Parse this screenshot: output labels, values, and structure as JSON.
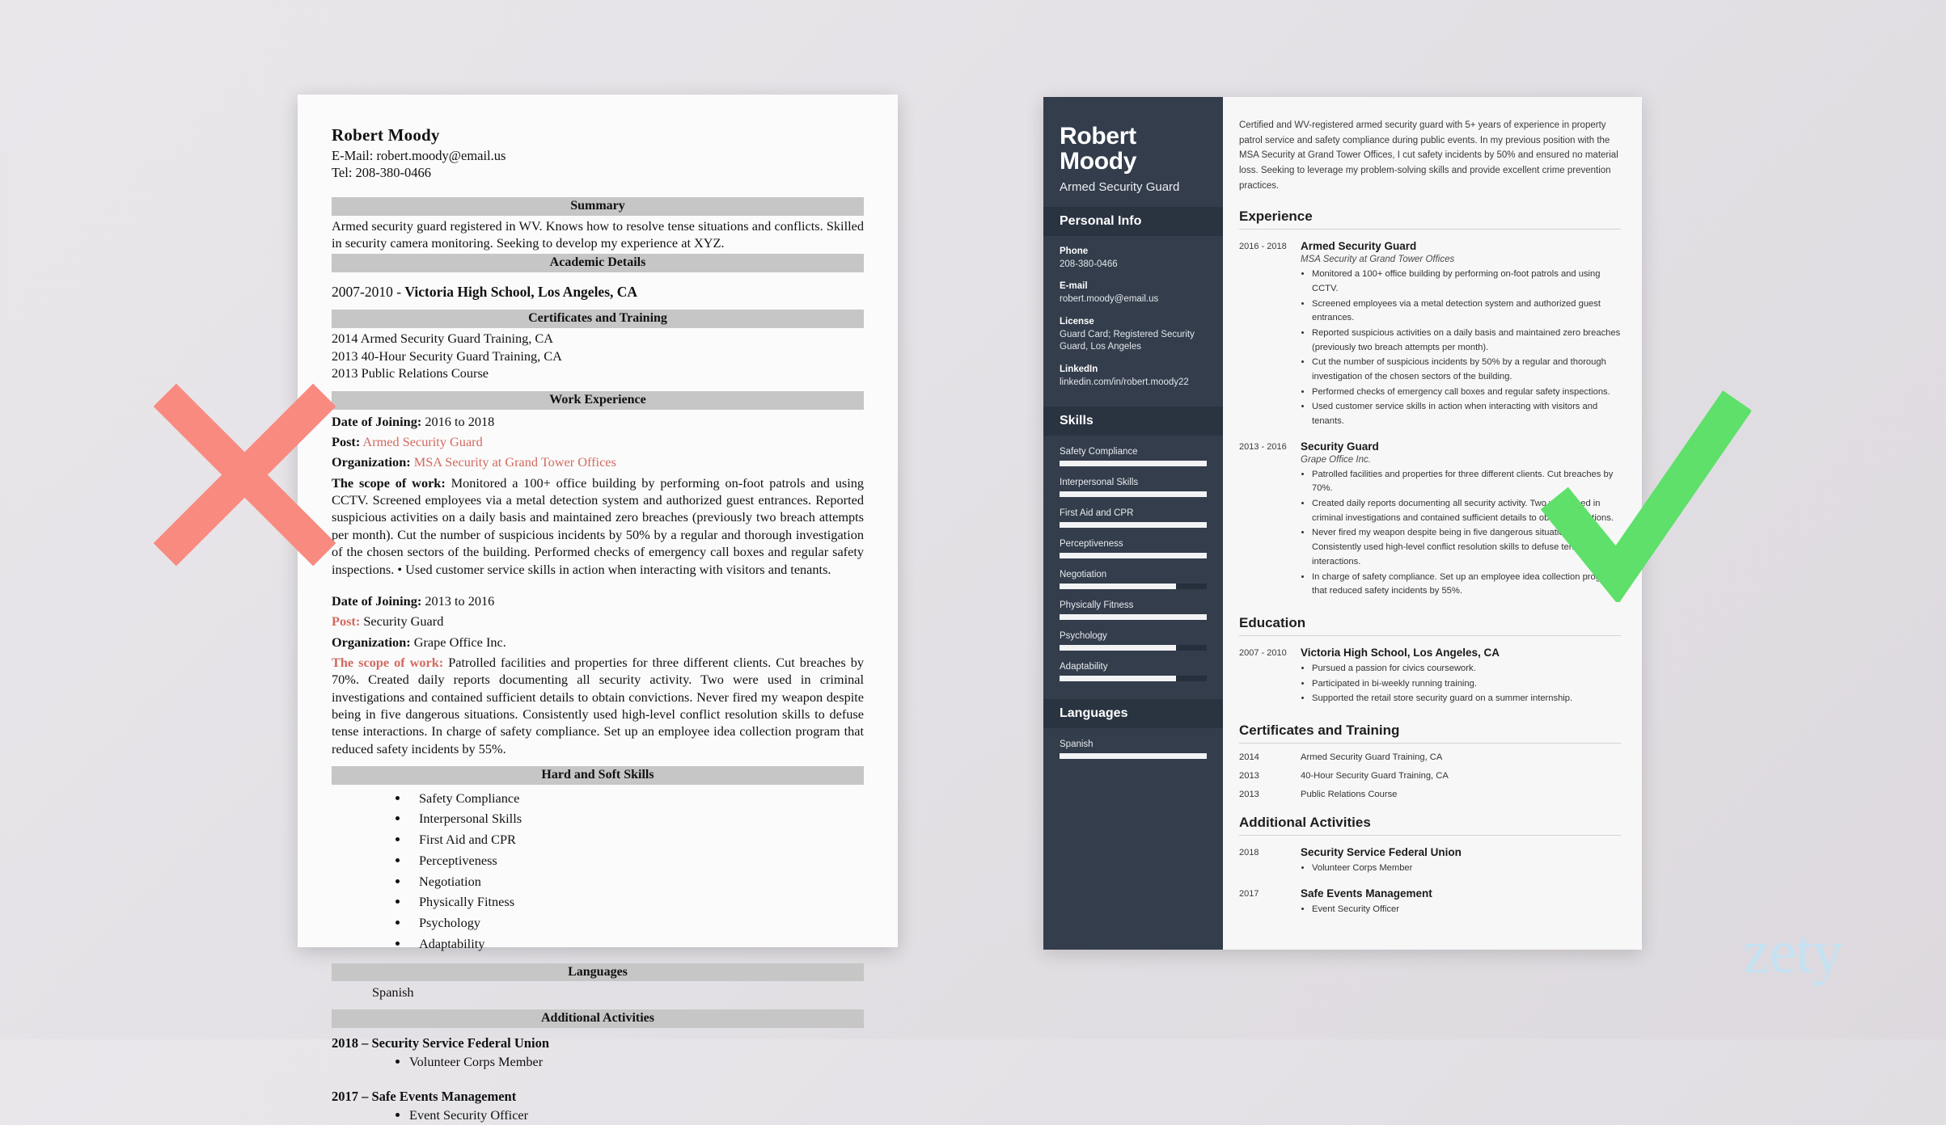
{
  "bad_resume": {
    "name": "Robert Moody",
    "email_line": "E-Mail: robert.moody@email.us",
    "tel_line": "Tel: 208-380-0466",
    "summary_heading": "Summary",
    "summary_text": "Armed security guard registered in WV. Knows how to resolve tense situations and conflicts. Skilled in security camera monitoring. Seeking to develop my experience at XYZ.",
    "academic_heading": "Academic Details",
    "academic_years": "2007-2010 - ",
    "academic_school": "Victoria High School, Los Angeles, CA",
    "certificates_heading": "Certificates and Training",
    "certificates": [
      "2014 Armed Security Guard Training, CA",
      "2013 40-Hour Security Guard Training, CA",
      "2013 Public Relations Course"
    ],
    "work_heading": "Work Experience",
    "jobs": [
      {
        "date_label": "Date of Joining:",
        "date_value": " 2016 to 2018",
        "post_label": "Post:",
        "post_value": " Armed Security Guard",
        "org_label": "Organization:",
        "org_value": " MSA Security at Grand Tower Offices",
        "scope_label": "The scope of work:",
        "scope_value": " Monitored a 100+ office building by performing on-foot patrols and using CCTV. Screened employees via a metal detection system and authorized guest entrances. Reported suspicious activities on a daily basis and maintained zero breaches (previously two breach attempts per month). Cut the number of suspicious incidents by 50% by a regular and thorough investigation of the chosen sectors of the building. Performed checks of emergency call boxes and regular safety inspections. • Used customer service skills in action when interacting with visitors and tenants."
      },
      {
        "date_label": "Date of Joining:",
        "date_value": " 2013 to 2016",
        "post_label": "Post:",
        "post_value": " Security Guard",
        "org_label": "Organization:",
        "org_value": " Grape Office Inc.",
        "scope_label": "The scope of work:",
        "scope_value": " Patrolled facilities and properties for three different clients. Cut breaches by 70%. Created daily reports documenting all security activity. Two were used in criminal investigations and contained sufficient details to obtain convictions. Never fired my weapon despite being in five dangerous situations. Consistently used high-level conflict resolution skills to defuse tense interactions. In charge of safety compliance. Set up an employee idea collection program that reduced safety incidents by 55%."
      }
    ],
    "skills_heading": "Hard and Soft Skills",
    "skills": [
      "Safety Compliance",
      "Interpersonal Skills",
      "First Aid and CPR",
      "Perceptiveness",
      "Negotiation",
      "Physically Fitness",
      "Psychology",
      "Adaptability"
    ],
    "languages_heading": "Languages",
    "languages": [
      "Spanish"
    ],
    "activities_heading": "Additional Activities",
    "activities": [
      {
        "title": "2018 – Security Service Federal Union",
        "items": [
          "Volunteer Corps Member"
        ]
      },
      {
        "title": "2017 – Safe Events Management",
        "items": [
          "Event Security Officer"
        ]
      }
    ]
  },
  "good_resume": {
    "sidebar": {
      "name_line1": "Robert",
      "name_line2": "Moody",
      "job_title": "Armed Security Guard",
      "personal_info_heading": "Personal Info",
      "fields": [
        {
          "label": "Phone",
          "value": "208-380-0466"
        },
        {
          "label": "E-mail",
          "value": "robert.moody@email.us"
        },
        {
          "label": "License",
          "value": "Guard Card; Registered Security Guard, Los Angeles"
        },
        {
          "label": "LinkedIn",
          "value": "linkedin.com/in/robert.moody22"
        }
      ],
      "skills_heading": "Skills",
      "skills": [
        {
          "label": "Safety Compliance",
          "level": 100
        },
        {
          "label": "Interpersonal Skills",
          "level": 100
        },
        {
          "label": "First Aid and CPR",
          "level": 100
        },
        {
          "label": "Perceptiveness",
          "level": 100
        },
        {
          "label": "Negotiation",
          "level": 79
        },
        {
          "label": "Physically Fitness",
          "level": 100
        },
        {
          "label": "Psychology",
          "level": 79
        },
        {
          "label": "Adaptability",
          "level": 79
        }
      ],
      "languages_heading": "Languages",
      "languages": [
        {
          "label": "Spanish",
          "level": 100
        }
      ]
    },
    "main": {
      "summary": "Certified and WV-registered armed security guard with 5+ years of experience in property patrol service and safety compliance during public events. In my previous position with the MSA Security at Grand Tower Offices, I cut safety incidents by 50% and ensured no material loss. Seeking to leverage my problem-solving skills and provide excellent crime prevention practices.",
      "experience_heading": "Experience",
      "experience": [
        {
          "dates": "2016 - 2018",
          "title": "Armed Security Guard",
          "org": "MSA Security at Grand Tower Offices",
          "bullets": [
            "Monitored a 100+ office building by performing on-foot patrols and using CCTV.",
            "Screened employees via a metal detection system and authorized guest entrances.",
            "Reported suspicious activities on a daily basis and maintained zero breaches (previously two breach attempts per month).",
            "Cut the number of suspicious incidents by 50% by a regular and thorough investigation of the chosen sectors of the building.",
            "Performed checks of emergency call boxes and regular safety inspections.",
            "Used customer service skills in action when interacting with visitors and tenants."
          ]
        },
        {
          "dates": "2013 - 2016",
          "title": "Security Guard",
          "org": "Grape Office Inc.",
          "bullets": [
            "Patrolled facilities and properties for three different clients. Cut breaches by 70%.",
            "Created daily reports documenting all security activity. Two were used in criminal investigations and contained sufficient details to obtain convictions.",
            "Never fired my weapon despite being in five dangerous situations. Consistently used high-level conflict resolution skills to defuse tense interactions.",
            "In charge of safety compliance. Set up an employee idea collection program that reduced safety incidents by 55%."
          ]
        }
      ],
      "education_heading": "Education",
      "education": [
        {
          "dates": "2007 - 2010",
          "title": "Victoria High School, Los Angeles, CA",
          "bullets": [
            "Pursued a passion for civics coursework.",
            "Participated in bi-weekly running training.",
            "Supported the retail store security guard on a summer internship."
          ]
        }
      ],
      "certificates_heading": "Certificates and Training",
      "certificates": [
        {
          "year": "2014",
          "title": "Armed Security Guard Training, CA"
        },
        {
          "year": "2013",
          "title": "40-Hour Security Guard Training, CA"
        },
        {
          "year": "2013",
          "title": "Public Relations Course"
        }
      ],
      "activities_heading": "Additional Activities",
      "activities": [
        {
          "year": "2018",
          "title": "Security Service Federal Union",
          "bullets": [
            "Volunteer Corps Member"
          ]
        },
        {
          "year": "2017",
          "title": "Safe Events Management",
          "bullets": [
            "Event Security Officer"
          ]
        }
      ]
    }
  },
  "marks": {
    "reject_icon": "x-mark",
    "approve_icon": "check-mark",
    "reject_color": "#f98a80",
    "approve_color": "#5ee06a"
  },
  "branding": {
    "logo_text": "zety",
    "logo_color": "#c5e2f2"
  }
}
